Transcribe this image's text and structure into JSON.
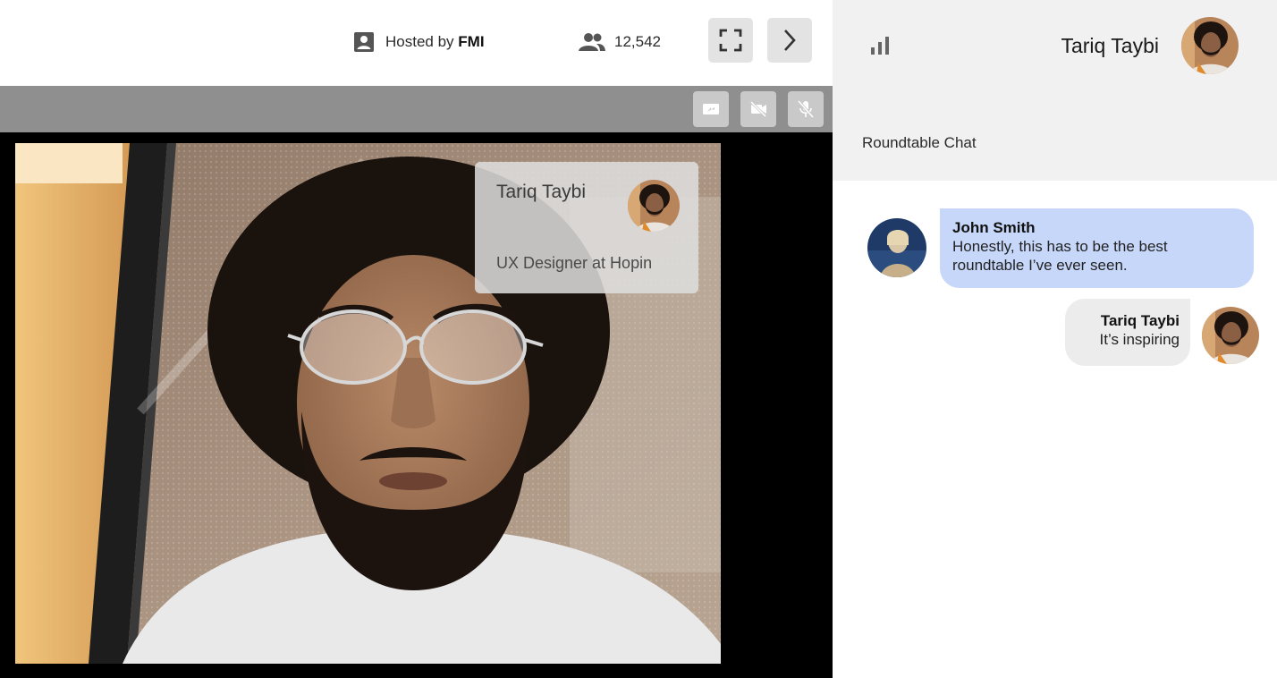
{
  "header": {
    "hosted_prefix": "Hosted by",
    "host_name": "FMI",
    "attendee_count": "12,542",
    "icons": [
      "person-badge-icon",
      "people-icon",
      "fullscreen-icon",
      "chevron-right-icon"
    ]
  },
  "controls": {
    "icons": [
      "screen-share-icon",
      "camera-off-icon",
      "mic-off-icon"
    ]
  },
  "speaker_card": {
    "name": "Tariq Taybi",
    "role": "UX Designer at Hopin"
  },
  "sidebar": {
    "user_name": "Tariq Taybi",
    "title": "Roundtable Chat",
    "icons": [
      "signal-bars-icon"
    ]
  },
  "chat": {
    "messages": [
      {
        "sender": "John Smith",
        "text_line1": "Honestly, this has to be the best",
        "text_line2": "roundtable I’ve ever seen."
      },
      {
        "sender": "Tariq Taybi",
        "text_line1": "It’s inspiring"
      }
    ]
  },
  "colors": {
    "incoming_bubble": "#c7d7fa",
    "outgoing_bubble": "#ececec",
    "sidebar_header": "#f1f1f1",
    "control_strip": "#8f8f8f"
  }
}
